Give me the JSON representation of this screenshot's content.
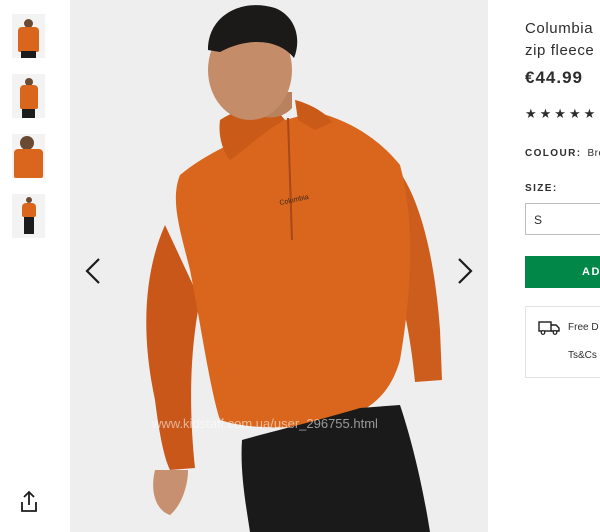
{
  "thumbnails": [
    {
      "alt": "front view"
    },
    {
      "alt": "side view"
    },
    {
      "alt": "close-up view"
    },
    {
      "alt": "full-length view"
    }
  ],
  "gallery": {
    "brand_logo_text": "Columbia",
    "watermark": "www.kidstaff.com.ua/user_296755.html"
  },
  "product": {
    "title_line1": "Columbia",
    "title_line2": "zip fleece",
    "price": "€44.99",
    "stars": "★★★★★",
    "colour_label": "COLOUR:",
    "colour_value": "Bro",
    "size_label": "SIZE:",
    "size_selected": "S",
    "add_button": "AD",
    "delivery_text": "Free D",
    "delivery_link": "Ts&Cs"
  },
  "colors": {
    "accent_green": "#018849",
    "garment_orange": "#d9661c",
    "background_gallery": "#eeeeee"
  },
  "icons": [
    "chevron-left-icon",
    "chevron-right-icon",
    "share-icon",
    "star-icon",
    "truck-icon"
  ]
}
